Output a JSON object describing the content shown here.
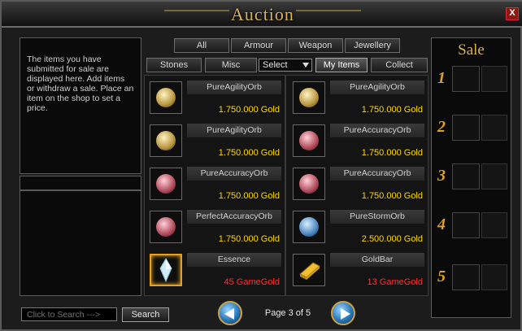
{
  "window": {
    "title": "Auction",
    "close_label": "X"
  },
  "info": {
    "text": "The items you have submitted for sale are displayed here. Add items or withdraw a sale. Place an item on the shop to set a price."
  },
  "tabs_row1": [
    {
      "label": "All"
    },
    {
      "label": "Armour"
    },
    {
      "label": "Weapon"
    },
    {
      "label": "Jewellery"
    }
  ],
  "tabs_row2": [
    {
      "label": "Stones"
    },
    {
      "label": "Misc"
    },
    {
      "label": "My Items",
      "active": true
    },
    {
      "label": "Collect"
    }
  ],
  "select": {
    "value": "Select"
  },
  "items": [
    {
      "name": "PureAgilityOrb",
      "price": "1.750.000 Gold",
      "icon": "agility-orb-icon",
      "color": "#d9c070",
      "currency": "gold"
    },
    {
      "name": "PureAgilityOrb",
      "price": "1.750.000 Gold",
      "icon": "agility-orb-icon",
      "color": "#d9c070",
      "currency": "gold"
    },
    {
      "name": "PureAgilityOrb",
      "price": "1.750.000 Gold",
      "icon": "agility-orb-icon",
      "color": "#d9c070",
      "currency": "gold"
    },
    {
      "name": "PureAccuracyOrb",
      "price": "1.750.000 Gold",
      "icon": "accuracy-orb-icon",
      "color": "#d0707a",
      "currency": "gold"
    },
    {
      "name": "PureAccuracyOrb",
      "price": "1.750.000 Gold",
      "icon": "accuracy-orb-icon",
      "color": "#d0707a",
      "currency": "gold"
    },
    {
      "name": "PureAccuracyOrb",
      "price": "1.750.000 Gold",
      "icon": "accuracy-orb-icon",
      "color": "#d0707a",
      "currency": "gold"
    },
    {
      "name": "PerfectAccuracyOrb",
      "price": "1.750.000 Gold",
      "icon": "accuracy-orb-icon",
      "color": "#d0707a",
      "currency": "gold"
    },
    {
      "name": "PureStormOrb",
      "price": "2.500.000 Gold",
      "icon": "storm-orb-icon",
      "color": "#70a8e0",
      "currency": "gold"
    },
    {
      "name": "Essence",
      "price": "45 GameGold",
      "icon": "essence-crystal-icon",
      "color": "#bfe0f0",
      "currency": "gamegold"
    },
    {
      "name": "GoldBar",
      "price": "13 GameGold",
      "icon": "gold-bar-icon",
      "color": "#e0b030",
      "currency": "gamegold"
    }
  ],
  "sale": {
    "title": "Sale",
    "slots": [
      "1",
      "2",
      "3",
      "4",
      "5"
    ]
  },
  "search": {
    "placeholder": "Click to Search --->",
    "button_label": "Search"
  },
  "pagination": {
    "text": "Page 3 of 5",
    "current": 3,
    "total": 5
  }
}
